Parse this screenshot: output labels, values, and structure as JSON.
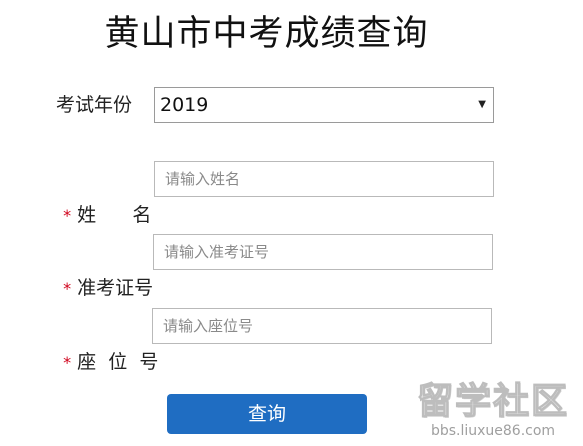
{
  "title": "黄山市中考成绩查询",
  "form": {
    "year": {
      "label": "考试年份",
      "value": "2019",
      "arrow": "▼"
    },
    "name": {
      "required_mark": "*",
      "label": "姓      名",
      "placeholder": "请输入姓名"
    },
    "ticket": {
      "required_mark": "*",
      "label": "准考证号",
      "placeholder": "请输入准考证号"
    },
    "seat": {
      "required_mark": "*",
      "label": "座  位  号",
      "placeholder": "请输入座位号"
    }
  },
  "submit_label": "查询",
  "watermark": {
    "logo": "留学社区",
    "url": "bbs.liuxue86.com"
  },
  "colors": {
    "button": "#1f6dc2",
    "required": "#d0021b"
  }
}
